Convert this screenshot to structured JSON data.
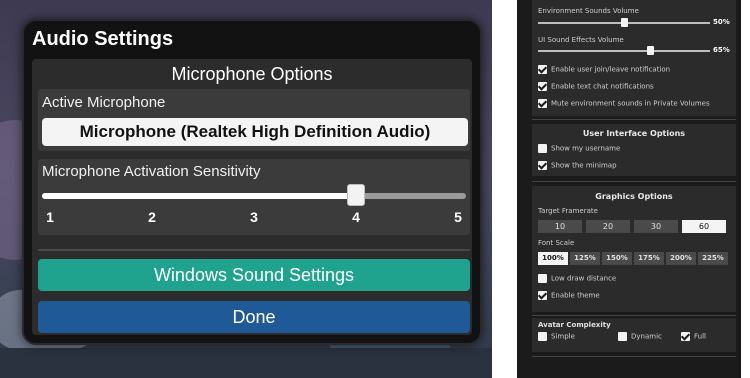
{
  "audio_dialog": {
    "title": "Audio Settings",
    "heading": "Microphone Options",
    "active_mic_label": "Active Microphone",
    "active_mic_value": "Microphone (Realtek High Definition Audio)",
    "sensitivity_label": "Microphone Activation Sensitivity",
    "sensitivity_ticks": [
      "1",
      "2",
      "3",
      "4",
      "5"
    ],
    "sensitivity_value": 4,
    "windows_sound_button": "Windows Sound Settings",
    "done_button": "Done"
  },
  "settings_panel": {
    "env_volume_label": "Environment Sounds Volume",
    "env_volume_value": "50%",
    "env_volume_fraction": 0.5,
    "ui_volume_label": "UI Sound Effects Volume",
    "ui_volume_value": "65%",
    "ui_volume_fraction": 0.65,
    "checkboxes_audio": [
      {
        "label": "Enable user join/leave notification",
        "checked": true
      },
      {
        "label": "Enable text chat notifications",
        "checked": true
      },
      {
        "label": "Mute environment sounds in Private Volumes",
        "checked": true
      }
    ],
    "ui_options_heading": "User Interface Options",
    "checkboxes_ui": [
      {
        "label": "Show my username",
        "checked": false
      },
      {
        "label": "Show the minimap",
        "checked": true
      }
    ],
    "graphics_heading": "Graphics Options",
    "framerate_label": "Target Framerate",
    "framerate_options": [
      "10",
      "20",
      "30",
      "60"
    ],
    "framerate_selected": "60",
    "font_scale_label": "Font Scale",
    "font_scale_options": [
      "100%",
      "125%",
      "150%",
      "175%",
      "200%",
      "225%"
    ],
    "font_scale_selected": "100%",
    "checkboxes_graphics": [
      {
        "label": "Low draw distance",
        "checked": false
      },
      {
        "label": "Enable theme",
        "checked": true
      }
    ],
    "avatar_heading": "Avatar Complexity",
    "avatar_options": [
      {
        "label": "Simple",
        "checked": false
      },
      {
        "label": "Dynamic",
        "checked": false
      },
      {
        "label": "Full",
        "checked": true
      }
    ]
  },
  "colors": {
    "windows_sound_button": "#1fa38e",
    "done_button": "#1f5a96",
    "panel_bg": "#121212"
  }
}
